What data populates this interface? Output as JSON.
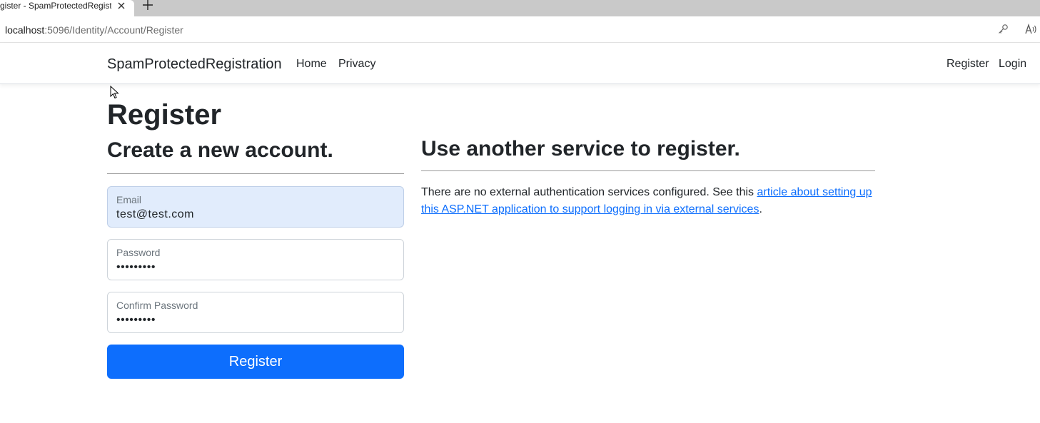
{
  "browser": {
    "tab_title": "gister - SpamProtectedRegistr",
    "url_host": "localhost",
    "url_path": ":5096/Identity/Account/Register",
    "icons": [
      "close-icon",
      "plus-icon",
      "key-icon",
      "read-aloud-icon"
    ]
  },
  "navbar": {
    "brand": "SpamProtectedRegistration",
    "links": [
      "Home",
      "Privacy"
    ],
    "right_links": [
      "Register",
      "Login"
    ]
  },
  "page": {
    "title": "Register",
    "subtitle": "Create a new account.",
    "form": {
      "email_label": "Email",
      "email_value": "test@test.com",
      "password_label": "Password",
      "password_value": "•••••••••",
      "confirm_label": "Confirm Password",
      "confirm_value": "•••••••••",
      "submit_label": "Register"
    },
    "external": {
      "heading": "Use another service to register.",
      "text_before": "There are no external authentication services configured. See this ",
      "link_text": "article about setting up this ASP.NET application to support logging in via external services",
      "text_after": "."
    }
  },
  "colors": {
    "primary": "#0d6efd",
    "autofill_bg": "#e1ecfc"
  }
}
